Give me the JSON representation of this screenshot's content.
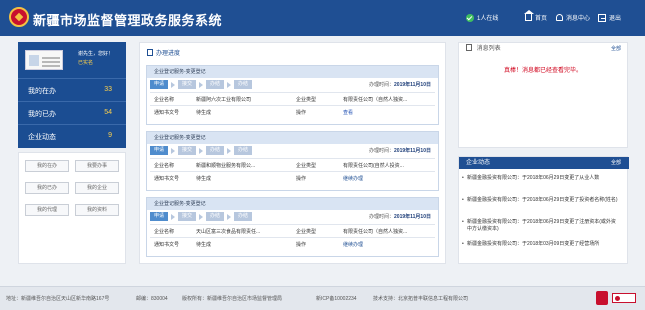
{
  "header": {
    "title": "新疆市场监督管理政务服务系统",
    "online": "1人在线",
    "home": "首页",
    "messages": "消息中心",
    "logout": "退出"
  },
  "user": {
    "greeting": "谢先生，您好！",
    "status": "已实名",
    "stats": [
      {
        "label": "我的在办",
        "count": "33"
      },
      {
        "label": "我的已办",
        "count": "54"
      },
      {
        "label": "企业动态",
        "count": "9"
      }
    ]
  },
  "quick_links": [
    "我的在办",
    "我要办事",
    "我的已办",
    "我的企业",
    "我的代理",
    "我的资料"
  ],
  "tasks": {
    "title": "办理进度",
    "steps": [
      "申请",
      "接交",
      "办结",
      "办结"
    ],
    "time_label": "办理时间：",
    "labels": {
      "company_name": "企业名称",
      "company_type": "企业类型",
      "notice": "通知书文号",
      "operation": "操作"
    },
    "items": [
      {
        "title": "企业登记服务-变更登记",
        "time": "2019年11月10日",
        "company_name": "新疆阿六次工业有限公司",
        "company_type": "有限责任公司（自然人独资...",
        "notice": "待生成",
        "action": "查看"
      },
      {
        "title": "企业登记服务-变更登记",
        "time": "2019年11月10日",
        "company_name": "新疆和顺物业服务有限公...",
        "company_type": "有限责任公司(自然人投资...",
        "notice": "待生成",
        "action": "继续办理"
      },
      {
        "title": "企业登记服务-变更登记",
        "time": "2019年11月10日",
        "company_name": "天山区富三次食品有限责任...",
        "company_type": "有限责任公司（自然人独资...",
        "notice": "待生成",
        "action": "继续办理"
      }
    ]
  },
  "messages": {
    "title": "消息列表",
    "all": "全部",
    "empty": "真棒！消息都已经查看完毕。"
  },
  "news": {
    "title": "企业动态",
    "all": "全部",
    "items": [
      "新疆金融投资有限公司：于2018年06月29日变更了从业人数",
      "新疆金融投资有限公司：于2018年06月29日变更了投资者名称(姓名)",
      "新疆金融投资有限公司：于2018年06月29日变更了注册资本(或外资中方认缴资本)",
      "新疆金融投资有限公司：于2018年03月09日变更了经营场所"
    ]
  },
  "footer": {
    "address": "地址：新疆维吾尔自治区天山区新华南路167号",
    "zip": "邮编：830004",
    "copyright": "版权所有：新疆维吾尔自治区市场监督管理局",
    "icp": "新ICP备10002234",
    "support": "技术支持：北京拓普丰联信息工程有限公司"
  },
  "colors": {
    "header_bg": "#1f4f93",
    "accent": "#4f8ccd",
    "alert_red": "#c8102e",
    "count_yellow": "#ffd24a"
  }
}
